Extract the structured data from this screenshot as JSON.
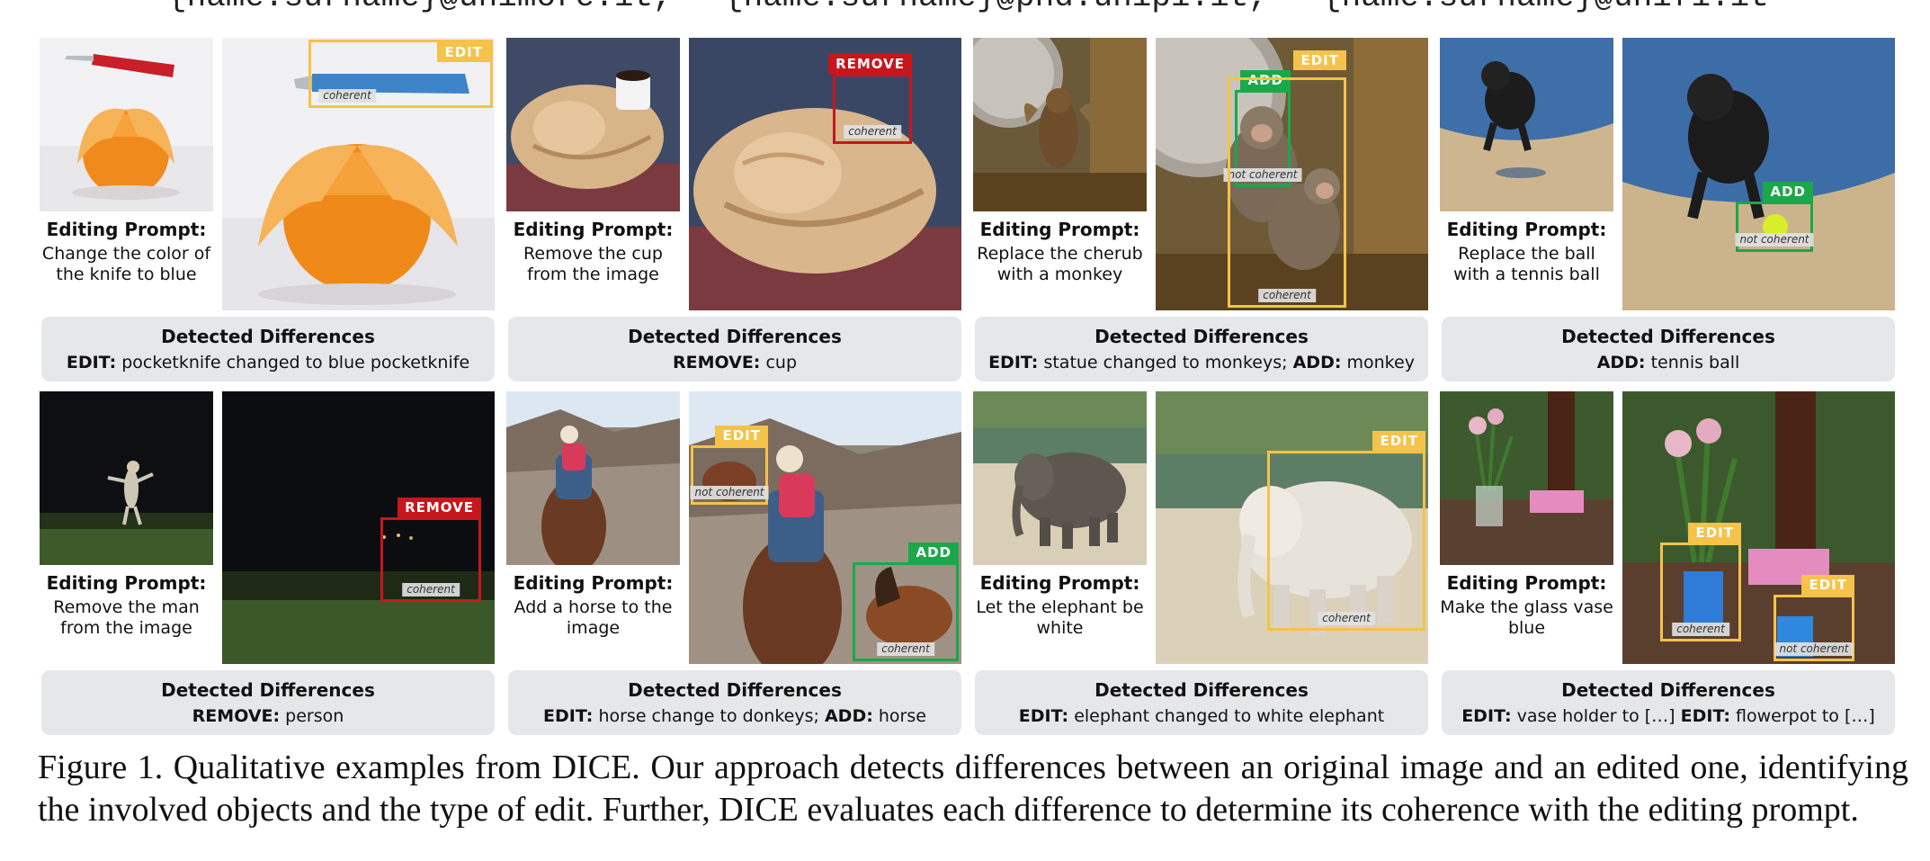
{
  "emails": [
    "{name.surname}@unimore.it,",
    "{name.surname}@phd.unipi.it,",
    "{name.surname}@unifi.it"
  ],
  "labels": {
    "prompt_header": "Editing Prompt:",
    "diff_header": "Detected Differences"
  },
  "panels": [
    {
      "prompt": "Change the color of the knife to blue",
      "diffs": [
        {
          "type": "EDIT:",
          "text": "pocketknife changed to blue pocketknife"
        }
      ],
      "boxes": [
        {
          "type": "EDIT",
          "caption": "coherent"
        }
      ]
    },
    {
      "prompt": "Remove the cup from the image",
      "diffs": [
        {
          "type": "REMOVE:",
          "text": "cup"
        }
      ],
      "boxes": [
        {
          "type": "REMOVE",
          "caption": "coherent"
        }
      ]
    },
    {
      "prompt": "Replace the cherub with a monkey",
      "diffs": [
        {
          "type": "EDIT:",
          "text": "statue changed to monkeys;"
        },
        {
          "type": "ADD:",
          "text": "monkey"
        }
      ],
      "boxes": [
        {
          "type": "ADD",
          "caption": "not coherent"
        },
        {
          "type": "EDIT",
          "caption": "coherent"
        }
      ]
    },
    {
      "prompt": "Replace the ball with a tennis ball",
      "diffs": [
        {
          "type": "ADD:",
          "text": "tennis ball"
        }
      ],
      "boxes": [
        {
          "type": "ADD",
          "caption": "not coherent"
        }
      ]
    },
    {
      "prompt": "Remove the man from the image",
      "diffs": [
        {
          "type": "REMOVE:",
          "text": "person"
        }
      ],
      "boxes": [
        {
          "type": "REMOVE",
          "caption": "coherent"
        }
      ]
    },
    {
      "prompt": "Add a horse to the image",
      "diffs": [
        {
          "type": "EDIT:",
          "text": "horse change to donkeys;"
        },
        {
          "type": "ADD:",
          "text": "horse"
        }
      ],
      "boxes": [
        {
          "type": "EDIT",
          "caption": "not coherent"
        },
        {
          "type": "ADD",
          "caption": "coherent"
        }
      ]
    },
    {
      "prompt": "Let the elephant be white",
      "diffs": [
        {
          "type": "EDIT:",
          "text": "elephant changed to white elephant"
        }
      ],
      "boxes": [
        {
          "type": "EDIT",
          "caption": "coherent"
        }
      ]
    },
    {
      "prompt": "Make the glass vase blue",
      "diffs": [
        {
          "type": "EDIT:",
          "text": "vase holder to […]"
        },
        {
          "type": "EDIT:",
          "text": "flowerpot to […]"
        }
      ],
      "boxes": [
        {
          "type": "EDIT",
          "caption": "coherent"
        },
        {
          "type": "EDIT",
          "caption": "not coherent"
        }
      ]
    }
  ],
  "caption": "Figure 1. Qualitative examples from DICE. Our approach detects differences between an original image and an edited one, identifying the involved objects and the type of edit. Further, DICE evaluates each difference to determine its coherence with the editing prompt.",
  "colors": {
    "edit": "#f5c24a",
    "remove": "#c7161d",
    "add": "#1aa84b",
    "diff_background": "#e6e7e9"
  }
}
